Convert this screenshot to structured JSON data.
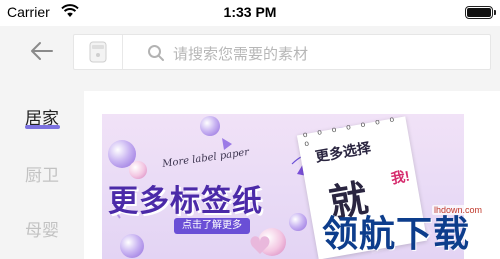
{
  "status_bar": {
    "carrier": "Carrier",
    "time": "1:33 PM"
  },
  "search": {
    "placeholder": "请搜索您需要的素材"
  },
  "sidebar": {
    "items": [
      {
        "label": "居家",
        "active": true
      },
      {
        "label": "厨卫"
      },
      {
        "label": "母婴"
      }
    ]
  },
  "banner": {
    "script_text": "More label paper",
    "title": "更多标签纸",
    "cta": "点击了解更多",
    "note_sub": "更多选择",
    "note_big": "就",
    "note_me": "我!"
  },
  "watermark": {
    "logo_text": "领航下载",
    "url": "lhdown.com"
  },
  "colors": {
    "accent": "#7c72e0",
    "banner_title": "#4b2aa8",
    "cta_bg": "#6a4fd6"
  }
}
